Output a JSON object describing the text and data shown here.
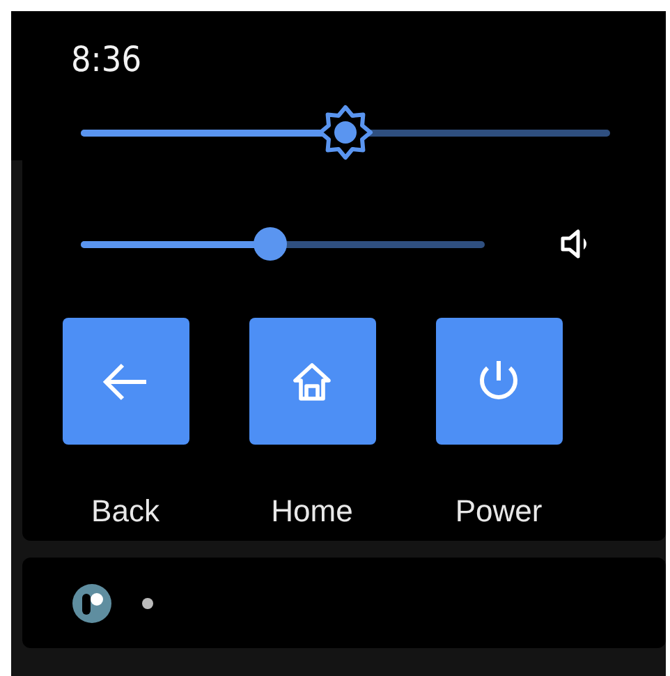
{
  "status_bar": {
    "time": "8:36"
  },
  "sliders": [
    {
      "kind": "brightness",
      "level": 0.5
    },
    {
      "kind": "volume",
      "level": 0.47
    }
  ],
  "buttons": [
    {
      "kind": "back",
      "label": "Back"
    },
    {
      "kind": "home",
      "label": "Home"
    },
    {
      "kind": "power",
      "label": "Power"
    }
  ],
  "notification_bar": {
    "items": [
      {
        "kind": "app"
      },
      {
        "kind": "dot"
      }
    ]
  }
}
